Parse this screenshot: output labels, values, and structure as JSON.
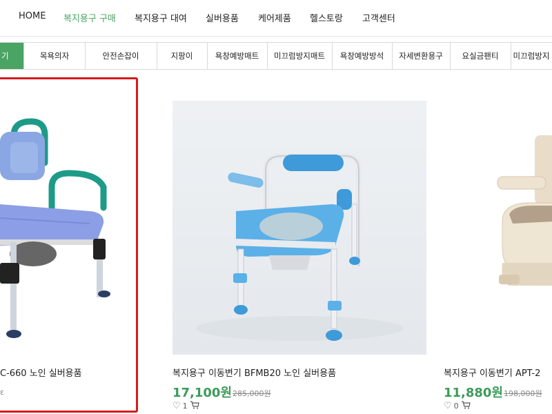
{
  "top_nav": [
    "HOME",
    "복지용구 구매",
    "복지용구 대여",
    "실버용품",
    "케어제품",
    "헬스토랑",
    "고객센터"
  ],
  "categories": [
    "기",
    "목욕의자",
    "안전손잡이",
    "지팡이",
    "욕창예방매트",
    "미끄럼방지매트",
    "욕창예방방석",
    "자세변환용구",
    "요실금팬티",
    "미끄럼방지"
  ],
  "products": [
    {
      "title": "C-660 노인 실버용품",
      "price": "",
      "original_price": "",
      "wishes": "",
      "cart": ""
    },
    {
      "title": "복지용구 이동변기 BFMB20 노인 실버용품",
      "price": "17,100원",
      "original_price": "285,000원",
      "wishes": "1",
      "cart": ""
    },
    {
      "title": "복지용구 이동변기 APT-2",
      "price": "11,880원",
      "original_price": "198,000원",
      "wishes": "0",
      "cart": ""
    }
  ],
  "colors": {
    "accent": "#4aa463",
    "price": "#3c9b59",
    "highlight": "#d7191c"
  }
}
